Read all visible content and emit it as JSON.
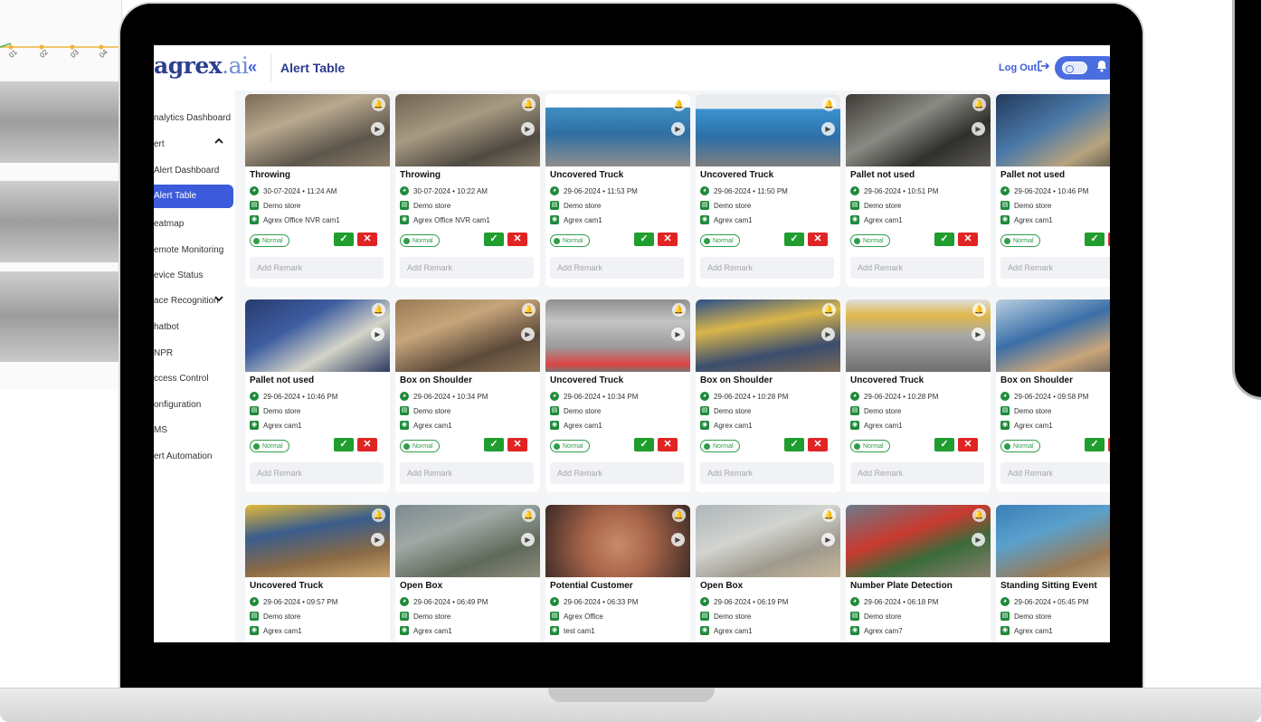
{
  "header": {
    "logo_main": "agrex",
    "logo_suffix": ".ai",
    "collapse_glyph": "«",
    "title": "Alert Table",
    "logout_label": "Log Out",
    "logout_icon": "logout-icon",
    "bell_icon": "bell-icon"
  },
  "background_chart": {
    "ticks": [
      "01",
      "02",
      "03",
      "04"
    ]
  },
  "sidebar": {
    "items": [
      {
        "label": "nalytics Dashboard"
      },
      {
        "label": "ert"
      },
      {
        "label": "Alert Dashboard"
      },
      {
        "label": "Alert Table"
      },
      {
        "label": "eatmap"
      },
      {
        "label": "emote Monitoring"
      },
      {
        "label": "evice Status"
      },
      {
        "label": "ace Recognition"
      },
      {
        "label": "hatbot"
      },
      {
        "label": "NPR"
      },
      {
        "label": "ccess Control"
      },
      {
        "label": "onfiguration"
      },
      {
        "label": "MS"
      },
      {
        "label": "ert Automation"
      }
    ],
    "active": "Alert Table"
  },
  "labels": {
    "status": "Normal",
    "remark_placeholder": "Add Remark"
  },
  "colors": {
    "accent": "#3b5bdb",
    "approve": "#1f9d2e",
    "reject": "#e02424",
    "status_green": "#2e9d4a"
  },
  "cards": [
    {
      "title": "Throwing",
      "datetime": "30-07-2024 • 11:24 AM",
      "store": "Demo store",
      "camera": "Agrex Office NVR cam1"
    },
    {
      "title": "Throwing",
      "datetime": "30-07-2024 • 10:22 AM",
      "store": "Demo store",
      "camera": "Agrex Office NVR cam1"
    },
    {
      "title": "Uncovered Truck",
      "datetime": "29-06-2024 • 11:53 PM",
      "store": "Demo store",
      "camera": "Agrex cam1"
    },
    {
      "title": "Uncovered Truck",
      "datetime": "29-06-2024 • 11:50 PM",
      "store": "Demo store",
      "camera": "Agrex cam1"
    },
    {
      "title": "Pallet not used",
      "datetime": "29-06-2024 • 10:51 PM",
      "store": "Demo store",
      "camera": "Agrex cam1"
    },
    {
      "title": "Pallet not used",
      "datetime": "29-06-2024 • 10:46 PM",
      "store": "Demo store",
      "camera": "Agrex cam1"
    },
    {
      "title": "Pallet not used",
      "datetime": "29-06-2024 • 10:46 PM",
      "store": "Demo store",
      "camera": "Agrex cam1"
    },
    {
      "title": "Box on Shoulder",
      "datetime": "29-06-2024 • 10:34 PM",
      "store": "Demo store",
      "camera": "Agrex cam1"
    },
    {
      "title": "Uncovered Truck",
      "datetime": "29-06-2024 • 10:34 PM",
      "store": "Demo store",
      "camera": "Agrex cam1"
    },
    {
      "title": "Box on Shoulder",
      "datetime": "29-06-2024 • 10:28 PM",
      "store": "Demo store",
      "camera": "Agrex cam1"
    },
    {
      "title": "Uncovered Truck",
      "datetime": "29-06-2024 • 10:28 PM",
      "store": "Demo store",
      "camera": "Agrex cam1"
    },
    {
      "title": "Box on Shoulder",
      "datetime": "29-06-2024 • 09:58 PM",
      "store": "Demo store",
      "camera": "Agrex cam1"
    },
    {
      "title": "Uncovered Truck",
      "datetime": "29-06-2024 • 09:57 PM",
      "store": "Demo store",
      "camera": "Agrex cam1"
    },
    {
      "title": "Open Box",
      "datetime": "29-06-2024 • 06:49 PM",
      "store": "Demo store",
      "camera": "Agrex cam1"
    },
    {
      "title": "Potential Customer",
      "datetime": "29-06-2024 • 06:33 PM",
      "store": "Agrex Office",
      "camera": "test cam1"
    },
    {
      "title": "Open Box",
      "datetime": "29-06-2024 • 06:19 PM",
      "store": "Demo store",
      "camera": "Agrex cam1"
    },
    {
      "title": "Number Plate Detection",
      "datetime": "29-06-2024 • 06:18 PM",
      "store": "Demo store",
      "camera": "Agrex cam7"
    },
    {
      "title": "Standing Sitting Event",
      "datetime": "29-06-2024 • 05:45 PM",
      "store": "Demo store",
      "camera": "Agrex cam1"
    }
  ]
}
